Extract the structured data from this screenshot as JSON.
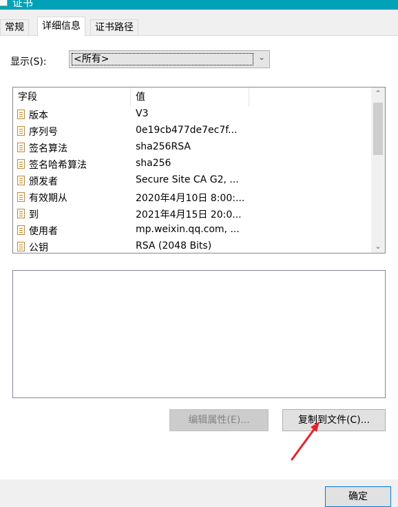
{
  "window": {
    "title": "证书"
  },
  "tabs": [
    {
      "label": "常规"
    },
    {
      "label": "详细信息"
    },
    {
      "label": "证书路径"
    }
  ],
  "show": {
    "label": "显示(S):",
    "selected": "<所有>"
  },
  "fields_list": {
    "headers": {
      "field": "字段",
      "value": "值"
    },
    "rows": [
      {
        "field": "版本",
        "value": "V3"
      },
      {
        "field": "序列号",
        "value": "0e19cb477de7ec7f..."
      },
      {
        "field": "签名算法",
        "value": "sha256RSA"
      },
      {
        "field": "签名哈希算法",
        "value": "sha256"
      },
      {
        "field": "颁发者",
        "value": "Secure Site CA G2, ..."
      },
      {
        "field": "有效期从",
        "value": "2020年4月10日 8:00:..."
      },
      {
        "field": "到",
        "value": "2021年4月15日 20:0..."
      },
      {
        "field": "使用者",
        "value": "mp.weixin.qq.com, ..."
      },
      {
        "field": "公钥",
        "value": "RSA (2048 Bits)"
      }
    ]
  },
  "buttons": {
    "edit_properties": "编辑属性(E)...",
    "copy_to_file": "复制到文件(C)...",
    "ok": "确定"
  },
  "colors": {
    "titlebar": "#00a2b8",
    "annotation_arrow": "#e8202a",
    "disabled_button": "#cccccc"
  },
  "icons": {
    "field_icon": "certificate-field-icon",
    "scroll_up": "chevron-up-icon",
    "scroll_down": "chevron-down-icon",
    "dropdown": "chevron-down-icon"
  }
}
